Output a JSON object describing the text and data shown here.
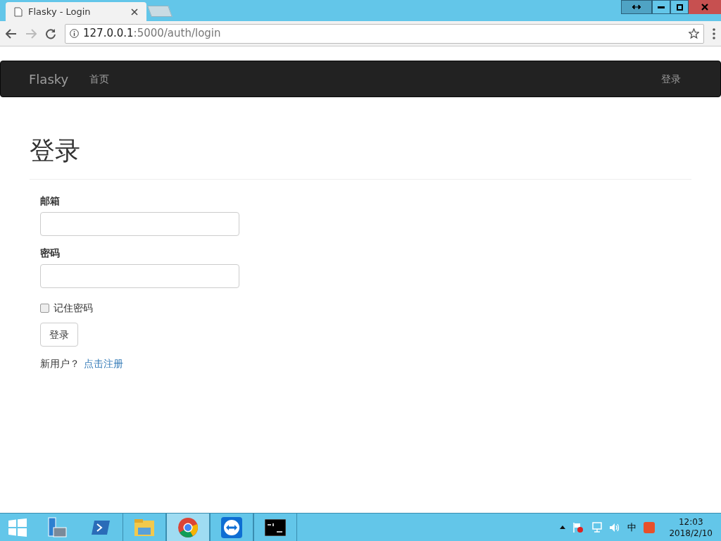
{
  "browser": {
    "tab": {
      "title": "Flasky - Login"
    },
    "url": {
      "host": "127.0.0.1",
      "rest": ":5000/auth/login"
    }
  },
  "navbar": {
    "brand": "Flasky",
    "links": [
      {
        "label": "首页"
      }
    ],
    "right_links": [
      {
        "label": "登录"
      }
    ]
  },
  "page": {
    "heading": "登录",
    "fields": [
      {
        "label": "邮箱"
      },
      {
        "label": "密码"
      }
    ],
    "remember": {
      "label": "记住密码",
      "checked": false
    },
    "submit": "登录",
    "register": {
      "prompt": "新用户？",
      "link": "点击注册"
    }
  },
  "taskbar": {
    "apps": [
      {
        "kind": "server",
        "active": false
      },
      {
        "kind": "shell",
        "active": false
      },
      {
        "kind": "folder",
        "active": false
      },
      {
        "kind": "chrome",
        "active": true
      },
      {
        "kind": "remote",
        "active": false
      },
      {
        "kind": "cmd",
        "active": false
      }
    ],
    "ime": "中",
    "time": "12:03",
    "date": "2018/2/10"
  }
}
